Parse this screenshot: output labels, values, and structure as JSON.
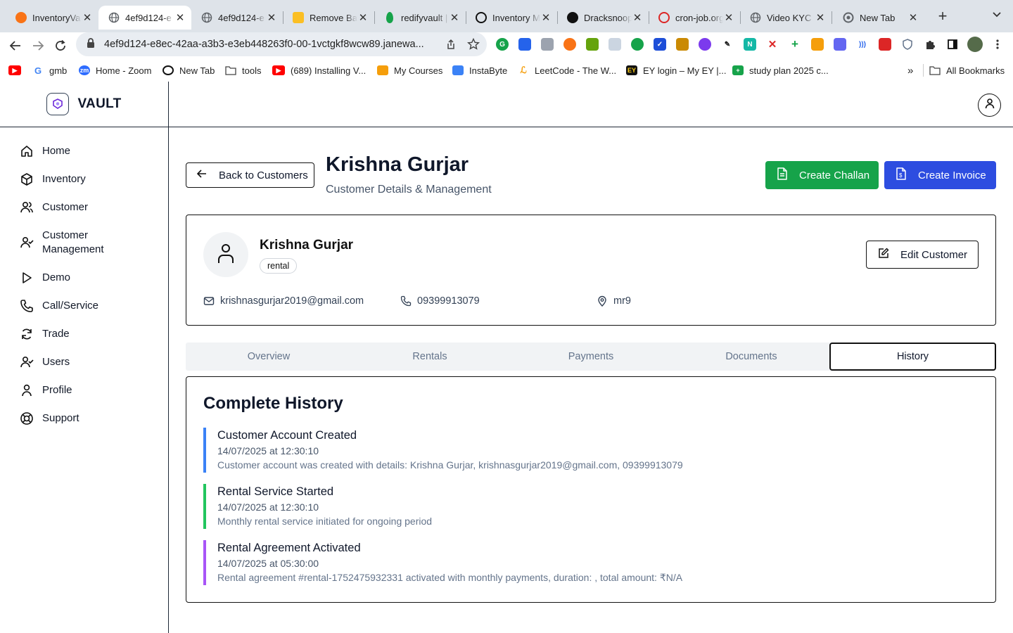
{
  "browser": {
    "tabs": [
      {
        "label": "InventoryVa",
        "favicon": "inventory-favicon",
        "color": "#f97316"
      },
      {
        "label": "4ef9d124-e",
        "favicon": "globe-favicon",
        "color": "#5f6368"
      },
      {
        "label": "4ef9d124-e",
        "favicon": "globe-favicon",
        "color": "#5f6368"
      },
      {
        "label": "Remove Bac",
        "favicon": "remove-bg-favicon",
        "color": "#fbbf24"
      },
      {
        "label": "redifyvault |",
        "favicon": "mongodb-favicon",
        "color": "#16a34a"
      },
      {
        "label": "Inventory M",
        "favicon": "openai-favicon",
        "color": "#111111"
      },
      {
        "label": "Dracksnoop",
        "favicon": "github-favicon",
        "color": "#111111"
      },
      {
        "label": "cron-job.org",
        "favicon": "cron-job-favicon",
        "color": "#dc2626"
      },
      {
        "label": "Video KYC",
        "favicon": "globe-favicon",
        "color": "#5f6368"
      },
      {
        "label": "New Tab",
        "favicon": "chrome-favicon",
        "color": "#5f6368"
      }
    ],
    "active_tab": 1,
    "url": "4ef9d124-e8ec-42aa-a3b3-e3eb448263f0-00-1vctgkf8wcw89.janewa...",
    "bookmarks": [
      {
        "label": "",
        "icon": "youtube-icon",
        "color": "#ff0000"
      },
      {
        "label": "gmb",
        "icon": "google-icon",
        "color": "#4285f4"
      },
      {
        "label": "Home - Zoom",
        "icon": "zoom-icon",
        "color": "#2d6cff"
      },
      {
        "label": "New Tab",
        "icon": "openai-icon",
        "color": "#111111"
      },
      {
        "label": "tools",
        "icon": "folder-icon",
        "color": "#5f6368"
      },
      {
        "label": "(689) Installing V...",
        "icon": "youtube-icon",
        "color": "#ff0000"
      },
      {
        "label": "My Courses",
        "icon": "courses-icon",
        "color": "#f59e0b"
      },
      {
        "label": "InstaByte",
        "icon": "instabyte-icon",
        "color": "#3b82f6"
      },
      {
        "label": "LeetCode - The W...",
        "icon": "leetcode-icon",
        "color": "#f59e0b"
      },
      {
        "label": "EY login – My EY |...",
        "icon": "ey-icon",
        "color": "#111111"
      },
      {
        "label": "study plan 2025 c...",
        "icon": "sheets-icon",
        "color": "#16a34a"
      }
    ],
    "all_bookmarks": "All Bookmarks"
  },
  "app": {
    "brand": "VAULT",
    "nav": [
      {
        "label": "Home",
        "icon": "home-icon"
      },
      {
        "label": "Inventory",
        "icon": "box-icon"
      },
      {
        "label": "Customer",
        "icon": "users-icon"
      },
      {
        "label": "Customer Management",
        "icon": "user-check-icon"
      },
      {
        "label": "Demo",
        "icon": "play-icon"
      },
      {
        "label": "Call/Service",
        "icon": "phone-icon"
      },
      {
        "label": "Trade",
        "icon": "refresh-icon"
      },
      {
        "label": "Users",
        "icon": "user-check-icon"
      },
      {
        "label": "Profile",
        "icon": "user-icon"
      },
      {
        "label": "Support",
        "icon": "life-buoy-icon"
      }
    ]
  },
  "page": {
    "back_label": "Back to Customers",
    "title": "Krishna Gurjar",
    "subtitle": "Customer Details & Management",
    "create_challan": "Create Challan",
    "create_invoice": "Create Invoice",
    "challan_color": "#16a34a",
    "invoice_color": "#2d4de0"
  },
  "customer": {
    "name": "Krishna Gurjar",
    "type": "rental",
    "edit_label": "Edit Customer",
    "email": "krishnasgurjar2019@gmail.com",
    "phone": "09399913079",
    "location": "mr9"
  },
  "tabs": [
    "Overview",
    "Rentals",
    "Payments",
    "Documents",
    "History"
  ],
  "active_tab": "History",
  "history": {
    "title": "Complete History",
    "items": [
      {
        "title": "Customer Account Created",
        "time": "14/07/2025 at 12:30:10",
        "description": "Customer account was created with details: Krishna Gurjar, krishnasgurjar2019@gmail.com, 09399913079",
        "color": "#3b82f6"
      },
      {
        "title": "Rental Service Started",
        "time": "14/07/2025 at 12:30:10",
        "description": "Monthly rental service initiated for ongoing period",
        "color": "#22c55e"
      },
      {
        "title": "Rental Agreement Activated",
        "time": "14/07/2025 at 05:30:00",
        "description": "Rental agreement #rental-1752475932331 activated with monthly payments, duration: , total amount: ₹N/A",
        "color": "#a855f7"
      }
    ]
  }
}
